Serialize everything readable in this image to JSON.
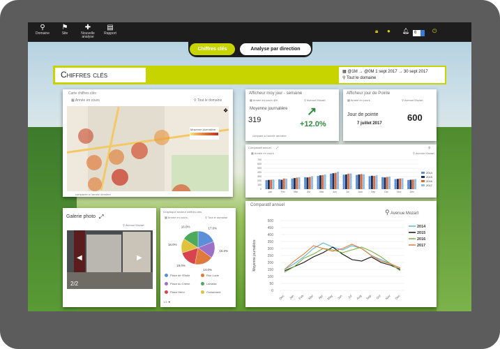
{
  "nav": {
    "items": [
      {
        "label": "Domaine",
        "icon": "domain-icon"
      },
      {
        "label": "Site",
        "icon": "map-pin-icon"
      },
      {
        "label": "Nouvelle analyse",
        "icon": "plus-icon"
      },
      {
        "label": "Rapport",
        "icon": "document-icon"
      }
    ]
  },
  "topbar_right": {
    "select_value": "6",
    "icons": [
      "lock-icon",
      "info-icon",
      "bell-icon",
      "power-icon"
    ]
  },
  "tabs": [
    {
      "label": "Chiffres clés"
    },
    {
      "label": "Analyse par direction"
    }
  ],
  "header": {
    "title": "Chiffres clés",
    "period_a": "@1M",
    "period_b": "@0M",
    "date_range": "1 sept 2017 → 30 sept 2017",
    "domain": "Tout le domaine"
  },
  "map_panel": {
    "title": "Carte chiffres clés",
    "filter": "Année en cours",
    "location": "Tout le domaine",
    "legend": "Moyenne journalière",
    "footer": "comparée à l'année dernière"
  },
  "afficheur_moy": {
    "title": "Afficheur moy jour - semaine",
    "filter_a": "Année en cours",
    "filter_b": "@0",
    "location": "Avenue Mozart",
    "label": "Moyenne journalière",
    "value": "319",
    "change": "+12.0%",
    "footer": "comparé à l'année dernière"
  },
  "afficheur_pointe": {
    "title": "Afficheur jour de Pointe",
    "filter": "Année en cours",
    "location": "Avenue Mozart",
    "label": "Jour de pointe",
    "date": "7 juillet 2017",
    "value": "600"
  },
  "comparatif_small": {
    "title": "Comparatif annuel",
    "filter": "Année en cours",
    "location": "Avenue Mozart"
  },
  "galerie": {
    "title": "Galerie photo",
    "location": "Avenue Mozart",
    "counter": "2/2"
  },
  "pie_panel": {
    "title": "Graphique secteur chiffres clés",
    "filter": "Année en cours",
    "location": "Tout le domaine",
    "footer": "1/3",
    "legend": [
      {
        "name": "Place de l'Etoile",
        "color": "#5b8fd8"
      },
      {
        "name": "Rue Lucie",
        "color": "#e07a3c"
      },
      {
        "name": "Place du Chêne",
        "color": "#9e6fc7"
      },
      {
        "name": "Lambda",
        "color": "#4caa5a"
      },
      {
        "name": "Place Henri",
        "color": "#d9434d"
      },
      {
        "name": "Croisement",
        "color": "#e0c23c"
      }
    ]
  },
  "comparatif_big": {
    "title": "Comparatif annuel",
    "location": "Avenue Mozart"
  },
  "chart_data": [
    {
      "type": "pie",
      "title": "Graphique secteur chiffres clés",
      "values": [
        19.0,
        16.0,
        18.0,
        17.0,
        14.0,
        16.0
      ],
      "labels": [
        "17.0%",
        "16.0%",
        "14.0%",
        "19.0%",
        "18.0%",
        "16.0%"
      ],
      "colors": [
        "#5b8fd8",
        "#9e6fc7",
        "#e07a3c",
        "#d9434d",
        "#e0c23c",
        "#4caa5a"
      ]
    },
    {
      "type": "bar",
      "title": "Comparatif annuel",
      "categories": [
        "Jan",
        "Fév",
        "Mar",
        "Avr",
        "Mai",
        "Jun",
        "Jul",
        "Aoû",
        "Sep",
        "Oct",
        "Nov",
        "Déc"
      ],
      "ylim": [
        0,
        700
      ],
      "yticks": [
        "0",
        "100",
        "200",
        "300",
        "400",
        "500",
        "600",
        "700"
      ],
      "series": [
        {
          "name": "2014",
          "color": "#5b8fd8",
          "values": [
            215,
            235,
            255,
            285,
            315,
            370,
            345,
            340,
            310,
            285,
            240,
            220
          ]
        },
        {
          "name": "2015",
          "color": "#1a2f5a",
          "values": [
            220,
            225,
            265,
            280,
            330,
            380,
            350,
            350,
            320,
            280,
            245,
            225
          ]
        },
        {
          "name": "2016",
          "color": "#dd6a3a",
          "values": [
            225,
            255,
            275,
            290,
            335,
            390,
            370,
            360,
            315,
            290,
            255,
            230
          ]
        },
        {
          "name": "2017",
          "color": "#8fbfe8",
          "values": [
            230,
            250,
            285,
            310,
            350,
            415,
            375,
            355,
            330,
            300,
            260,
            240
          ]
        }
      ]
    },
    {
      "type": "line",
      "title": "Comparatif annuel",
      "ylabel": "Moyenne journalière",
      "categories": [
        "Dec",
        "Jan",
        "Feb",
        "Mar",
        "Apr",
        "May",
        "Jun",
        "Jul",
        "Aug",
        "Sep",
        "Oct",
        "Nov",
        "Dec"
      ],
      "ylim": [
        0,
        500
      ],
      "yticks": [
        "0",
        "50",
        "100",
        "150",
        "200",
        "250",
        "300",
        "350",
        "400",
        "450",
        "500"
      ],
      "series": [
        {
          "name": "2014",
          "color": "#5bb5d8",
          "values": [
            150,
            190,
            240,
            300,
            340,
            310,
            290,
            320,
            300,
            250,
            220,
            190,
            160
          ]
        },
        {
          "name": "2015",
          "color": "#111111",
          "values": [
            140,
            170,
            200,
            240,
            270,
            310,
            260,
            220,
            210,
            240,
            200,
            180,
            150
          ]
        },
        {
          "name": "2016",
          "color": "#7ab648",
          "values": [
            130,
            170,
            230,
            260,
            300,
            290,
            270,
            290,
            310,
            280,
            240,
            190,
            140
          ]
        },
        {
          "name": "2017",
          "color": "#e07a3c",
          "values": [
            150,
            210,
            260,
            320,
            300,
            280,
            300,
            330,
            300,
            250,
            210,
            190,
            160
          ]
        }
      ]
    }
  ]
}
